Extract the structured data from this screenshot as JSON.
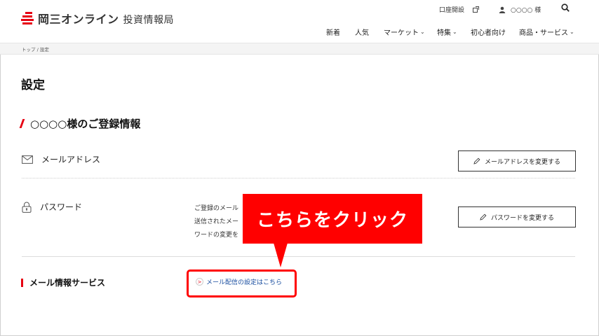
{
  "header": {
    "logo_brand": "岡三オンライン",
    "logo_sub": "投資情報局",
    "account_open": "口座開設",
    "user_name": "○○○○ 様",
    "nav": [
      {
        "label": "新着",
        "chevron": false
      },
      {
        "label": "人気",
        "chevron": false
      },
      {
        "label": "マーケット",
        "chevron": true
      },
      {
        "label": "特集",
        "chevron": true
      },
      {
        "label": "初心者向け",
        "chevron": false
      },
      {
        "label": "商品・サービス",
        "chevron": true
      }
    ]
  },
  "breadcrumb": "トップ / 設定",
  "page_title": "設定",
  "section_title": "○○○○様のご登録情報",
  "email": {
    "label": "メールアドレス",
    "button": "メールアドレスを変更する"
  },
  "password": {
    "label": "パスワード",
    "description_lines": [
      "ご登録のメール",
      "送信されたメー",
      "ワードの変更を"
    ],
    "button": "パスワードを変更する"
  },
  "mail_service": {
    "label": "メール情報サービス",
    "link": "メール配信の設定はこちら"
  },
  "callout": "こちらをクリック",
  "colors": {
    "brand_red": "#e60012",
    "callout_red": "#ff0000",
    "link_blue": "#1a4ea0"
  }
}
